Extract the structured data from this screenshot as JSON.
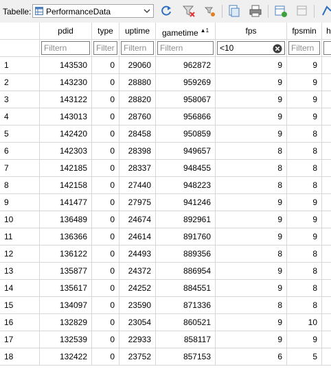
{
  "toolbar": {
    "table_label": "Tabelle:",
    "table_selected": "PerformanceData",
    "icons": [
      "table-icon",
      "refresh-icon",
      "clear-filters-icon",
      "save-filter-icon",
      "print-preview-icon",
      "print-icon",
      "new-record-icon",
      "delete-record-icon",
      "more-icon"
    ]
  },
  "columns": [
    {
      "key": "pdid",
      "label": "pdid",
      "filter_placeholder": "Filtern",
      "filter_value": ""
    },
    {
      "key": "type",
      "label": "type",
      "filter_placeholder": "Filtern",
      "filter_value": ""
    },
    {
      "key": "uptime",
      "label": "uptime",
      "filter_placeholder": "Filtern",
      "filter_value": ""
    },
    {
      "key": "gametime",
      "label": "gametime",
      "sort_indicator": "▲1",
      "filter_placeholder": "Filtern",
      "filter_value": ""
    },
    {
      "key": "fps",
      "label": "fps",
      "filter_placeholder": "Filtern",
      "filter_value": "<10"
    },
    {
      "key": "fpsmin",
      "label": "fpsmin",
      "filter_placeholder": "Filtern",
      "filter_value": ""
    },
    {
      "key": "h",
      "label": "h",
      "filter_placeholder": "",
      "filter_value": ""
    }
  ],
  "rows": [
    {
      "n": "1",
      "pdid": "143530",
      "type": "0",
      "uptime": "29060",
      "gametime": "962872",
      "fps": "9",
      "fpsmin": "9"
    },
    {
      "n": "2",
      "pdid": "143230",
      "type": "0",
      "uptime": "28880",
      "gametime": "959269",
      "fps": "9",
      "fpsmin": "9"
    },
    {
      "n": "3",
      "pdid": "143122",
      "type": "0",
      "uptime": "28820",
      "gametime": "958067",
      "fps": "9",
      "fpsmin": "9"
    },
    {
      "n": "4",
      "pdid": "143013",
      "type": "0",
      "uptime": "28760",
      "gametime": "956866",
      "fps": "9",
      "fpsmin": "9"
    },
    {
      "n": "5",
      "pdid": "142420",
      "type": "0",
      "uptime": "28458",
      "gametime": "950859",
      "fps": "9",
      "fpsmin": "8"
    },
    {
      "n": "6",
      "pdid": "142303",
      "type": "0",
      "uptime": "28398",
      "gametime": "949657",
      "fps": "8",
      "fpsmin": "8"
    },
    {
      "n": "7",
      "pdid": "142185",
      "type": "0",
      "uptime": "28337",
      "gametime": "948455",
      "fps": "8",
      "fpsmin": "8"
    },
    {
      "n": "8",
      "pdid": "142158",
      "type": "0",
      "uptime": "27440",
      "gametime": "948223",
      "fps": "8",
      "fpsmin": "8"
    },
    {
      "n": "9",
      "pdid": "141477",
      "type": "0",
      "uptime": "27975",
      "gametime": "941246",
      "fps": "9",
      "fpsmin": "9"
    },
    {
      "n": "10",
      "pdid": "136489",
      "type": "0",
      "uptime": "24674",
      "gametime": "892961",
      "fps": "9",
      "fpsmin": "9"
    },
    {
      "n": "11",
      "pdid": "136366",
      "type": "0",
      "uptime": "24614",
      "gametime": "891760",
      "fps": "9",
      "fpsmin": "9"
    },
    {
      "n": "12",
      "pdid": "136122",
      "type": "0",
      "uptime": "24493",
      "gametime": "889356",
      "fps": "8",
      "fpsmin": "8"
    },
    {
      "n": "13",
      "pdid": "135877",
      "type": "0",
      "uptime": "24372",
      "gametime": "886954",
      "fps": "9",
      "fpsmin": "8"
    },
    {
      "n": "14",
      "pdid": "135617",
      "type": "0",
      "uptime": "24252",
      "gametime": "884551",
      "fps": "9",
      "fpsmin": "8"
    },
    {
      "n": "15",
      "pdid": "134097",
      "type": "0",
      "uptime": "23590",
      "gametime": "871336",
      "fps": "8",
      "fpsmin": "8"
    },
    {
      "n": "16",
      "pdid": "132829",
      "type": "0",
      "uptime": "23054",
      "gametime": "860521",
      "fps": "9",
      "fpsmin": "10"
    },
    {
      "n": "17",
      "pdid": "132539",
      "type": "0",
      "uptime": "22933",
      "gametime": "858117",
      "fps": "9",
      "fpsmin": "9"
    },
    {
      "n": "18",
      "pdid": "132422",
      "type": "0",
      "uptime": "23752",
      "gametime": "857153",
      "fps": "6",
      "fpsmin": "5"
    }
  ]
}
